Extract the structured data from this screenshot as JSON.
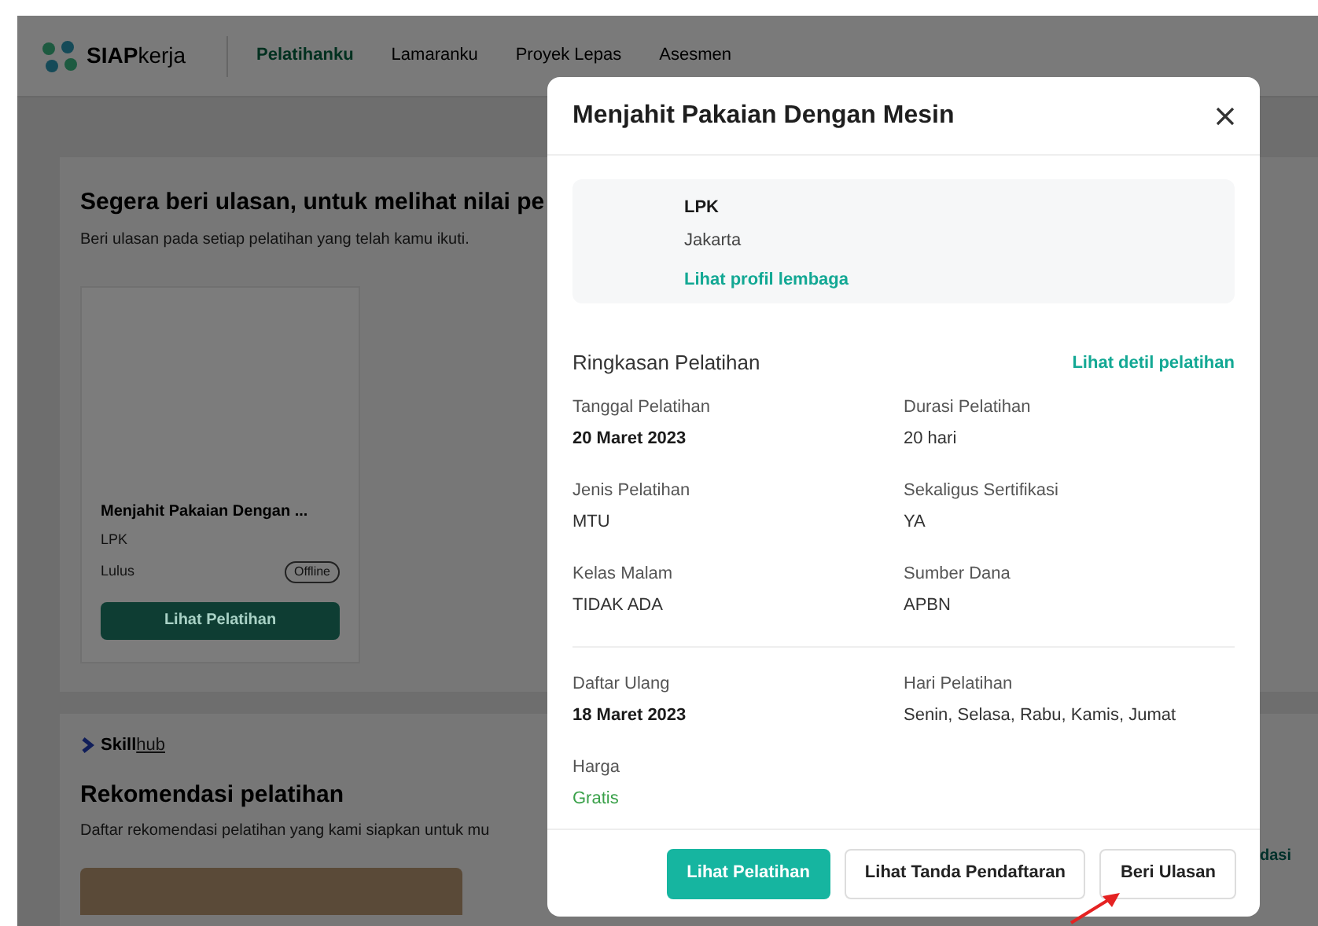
{
  "nav": {
    "logo": {
      "bold": "SIAP",
      "light": "kerja"
    },
    "items": [
      {
        "label": "Pelatihanku",
        "selected": true
      },
      {
        "label": "Lamaranku",
        "selected": false
      },
      {
        "label": "Proyek Lepas",
        "selected": false
      },
      {
        "label": "Asesmen",
        "selected": false
      }
    ]
  },
  "review_banner": {
    "title": "Segera beri ulasan, untuk melihat nilai pe",
    "subtitle": "Beri ulasan pada setiap pelatihan yang telah kamu ikuti.",
    "course_card": {
      "title": "Menjahit Pakaian Dengan ...",
      "provider": "LPK",
      "status": "Lulus",
      "mode": "Offline",
      "button": "Lihat Pelatihan"
    }
  },
  "skillhub": {
    "logo": {
      "bold": "Skill",
      "light": "hub"
    },
    "title": "Rekomendasi pelatihan",
    "subtitle": "Daftar rekomendasi pelatihan yang kami siapkan untuk mu",
    "see_all_fragment": "dasi"
  },
  "modal": {
    "title": "Menjahit Pakaian Dengan Mesin",
    "provider": {
      "name": "LPK",
      "city": "Jakarta",
      "link": "Lihat profil lembaga"
    },
    "summary_title": "Ringkasan Pelatihan",
    "summary_link": "Lihat detil pelatihan",
    "groups": [
      [
        {
          "label": "Tanggal Pelatihan",
          "value": "20 Maret 2023",
          "kind": "date"
        },
        {
          "label": "Durasi Pelatihan",
          "value": "20 hari",
          "kind": "plain"
        },
        {
          "label": "Jenis Pelatihan",
          "value": "MTU",
          "kind": "plain"
        },
        {
          "label": "Sekaligus Sertifikasi",
          "value": "YA",
          "kind": "plain"
        },
        {
          "label": "Kelas Malam",
          "value": "TIDAK ADA",
          "kind": "plain"
        },
        {
          "label": "Sumber Dana",
          "value": "APBN",
          "kind": "plain"
        }
      ],
      [
        {
          "label": "Daftar Ulang",
          "value": "18 Maret 2023",
          "kind": "date"
        },
        {
          "label": "Hari Pelatihan",
          "value": "Senin, Selasa, Rabu, Kamis, Jumat",
          "kind": "plain"
        },
        {
          "label": "Harga",
          "value": "Gratis",
          "kind": "price"
        }
      ]
    ],
    "buttons": [
      {
        "label": "Lihat Pelatihan",
        "kind": "primary"
      },
      {
        "label": "Lihat Tanda Pendaftaran",
        "kind": "outline"
      },
      {
        "label": "Beri Ulasan",
        "kind": "outline"
      }
    ]
  }
}
